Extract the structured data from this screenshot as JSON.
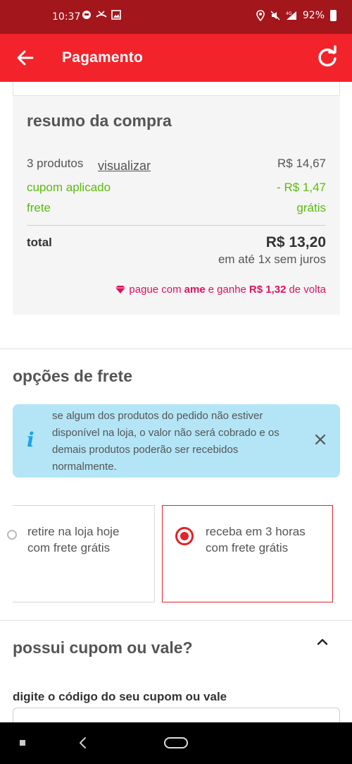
{
  "status_bar": {
    "time": "10:37",
    "battery_pct": "92%",
    "network": "4G"
  },
  "app_bar": {
    "title": "Pagamento"
  },
  "summary": {
    "title": "resumo da compra",
    "products_label": "3 produtos",
    "view_link": "visualizar",
    "products_value": "R$ 14,67",
    "coupon_label": "cupom aplicado",
    "coupon_value": "- R$ 1,47",
    "freight_label": "frete",
    "freight_value": "grátis",
    "total_label": "total",
    "total_value": "R$ 13,20",
    "installments": "em até 1x sem juros",
    "ame": {
      "prefix": "pague com",
      "brand": "ame",
      "middle": "e ganhe",
      "cashback": "R$ 1,32",
      "suffix": "de volta"
    }
  },
  "shipping": {
    "title": "opções de frete",
    "info_text": "se algum dos produtos do pedido não estiver disponível na loja, o valor não será cobrado e os demais produtos poderão ser recebidos normalmente.",
    "info_icon": "i",
    "options": [
      {
        "line1": "retire na loja hoje",
        "line2": "com frete grátis",
        "selected": false
      },
      {
        "line1": "receba em 3 horas",
        "line2": "com frete grátis",
        "selected": true
      }
    ]
  },
  "coupon": {
    "title": "possui cupom ou vale?",
    "input_label": "digite o código do seu cupom ou vale",
    "input_value": ""
  },
  "colors": {
    "brand_red": "#f2232a",
    "status_red": "#a3161b",
    "success_green": "#5bbb0e",
    "ame_pink": "#e0115f",
    "info_blue": "#b3e5f7"
  }
}
